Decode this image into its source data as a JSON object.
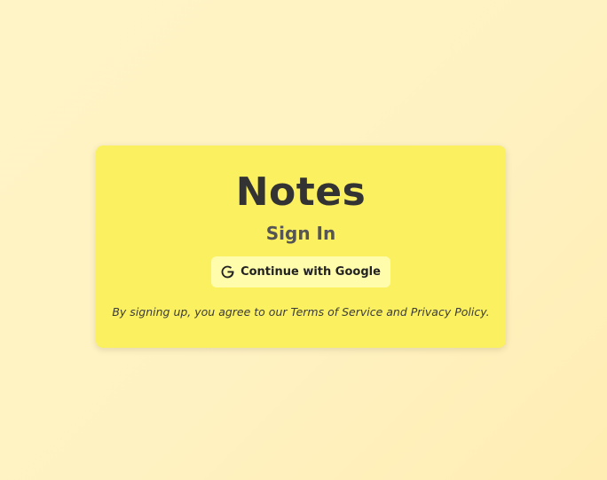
{
  "app": {
    "title": "Notes"
  },
  "auth": {
    "heading": "Sign In",
    "google_button_label": "Continue with Google",
    "google_icon": "google-icon",
    "terms_text": "By signing up, you agree to our Terms of Service and Privacy Policy."
  },
  "colors": {
    "background": "#fff2c2",
    "card": "#fbf05f",
    "button": "#fffcab",
    "text": "#333333"
  }
}
